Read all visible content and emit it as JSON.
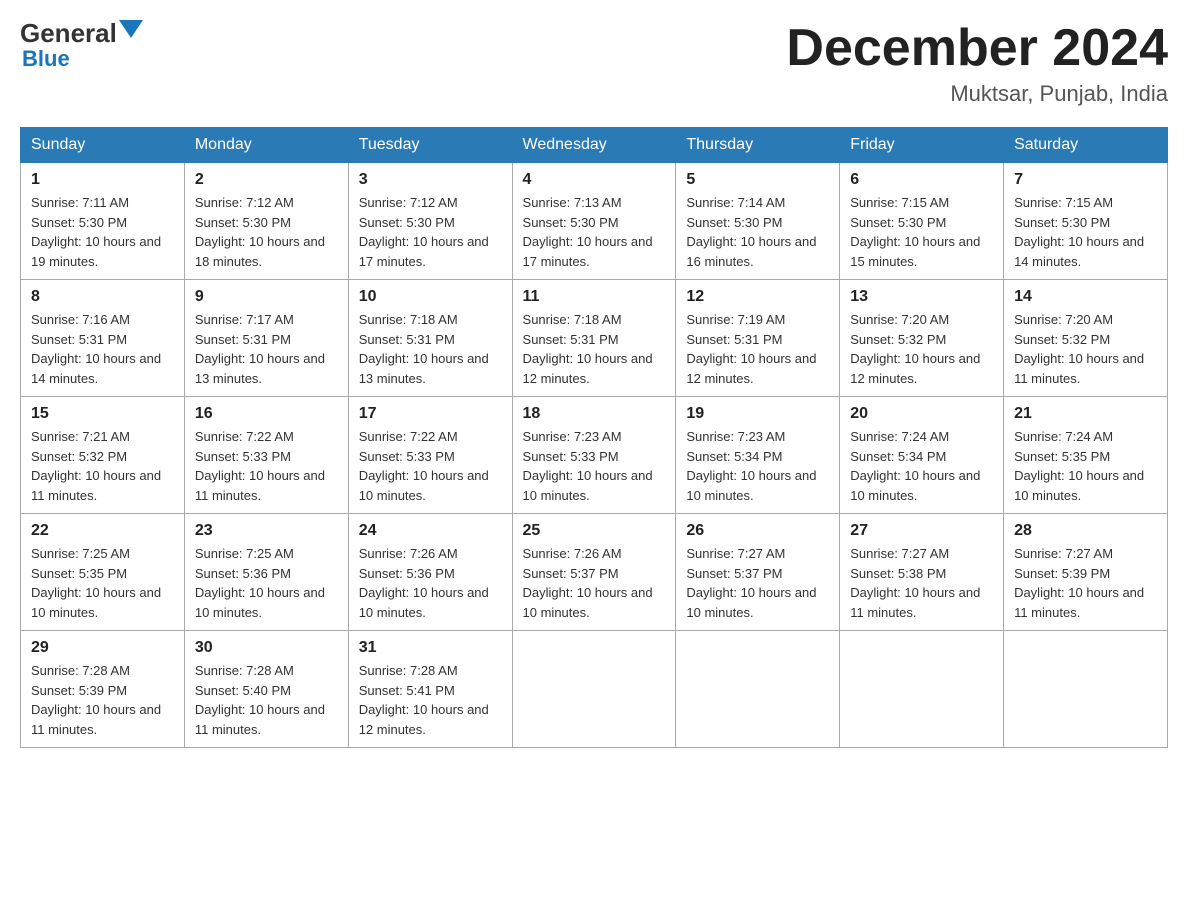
{
  "header": {
    "logo_general": "General",
    "logo_blue": "Blue",
    "month_title": "December 2024",
    "location": "Muktsar, Punjab, India"
  },
  "days_of_week": [
    "Sunday",
    "Monday",
    "Tuesday",
    "Wednesday",
    "Thursday",
    "Friday",
    "Saturday"
  ],
  "weeks": [
    [
      {
        "num": "1",
        "sunrise": "7:11 AM",
        "sunset": "5:30 PM",
        "daylight": "10 hours and 19 minutes."
      },
      {
        "num": "2",
        "sunrise": "7:12 AM",
        "sunset": "5:30 PM",
        "daylight": "10 hours and 18 minutes."
      },
      {
        "num": "3",
        "sunrise": "7:12 AM",
        "sunset": "5:30 PM",
        "daylight": "10 hours and 17 minutes."
      },
      {
        "num": "4",
        "sunrise": "7:13 AM",
        "sunset": "5:30 PM",
        "daylight": "10 hours and 17 minutes."
      },
      {
        "num": "5",
        "sunrise": "7:14 AM",
        "sunset": "5:30 PM",
        "daylight": "10 hours and 16 minutes."
      },
      {
        "num": "6",
        "sunrise": "7:15 AM",
        "sunset": "5:30 PM",
        "daylight": "10 hours and 15 minutes."
      },
      {
        "num": "7",
        "sunrise": "7:15 AM",
        "sunset": "5:30 PM",
        "daylight": "10 hours and 14 minutes."
      }
    ],
    [
      {
        "num": "8",
        "sunrise": "7:16 AM",
        "sunset": "5:31 PM",
        "daylight": "10 hours and 14 minutes."
      },
      {
        "num": "9",
        "sunrise": "7:17 AM",
        "sunset": "5:31 PM",
        "daylight": "10 hours and 13 minutes."
      },
      {
        "num": "10",
        "sunrise": "7:18 AM",
        "sunset": "5:31 PM",
        "daylight": "10 hours and 13 minutes."
      },
      {
        "num": "11",
        "sunrise": "7:18 AM",
        "sunset": "5:31 PM",
        "daylight": "10 hours and 12 minutes."
      },
      {
        "num": "12",
        "sunrise": "7:19 AM",
        "sunset": "5:31 PM",
        "daylight": "10 hours and 12 minutes."
      },
      {
        "num": "13",
        "sunrise": "7:20 AM",
        "sunset": "5:32 PM",
        "daylight": "10 hours and 12 minutes."
      },
      {
        "num": "14",
        "sunrise": "7:20 AM",
        "sunset": "5:32 PM",
        "daylight": "10 hours and 11 minutes."
      }
    ],
    [
      {
        "num": "15",
        "sunrise": "7:21 AM",
        "sunset": "5:32 PM",
        "daylight": "10 hours and 11 minutes."
      },
      {
        "num": "16",
        "sunrise": "7:22 AM",
        "sunset": "5:33 PM",
        "daylight": "10 hours and 11 minutes."
      },
      {
        "num": "17",
        "sunrise": "7:22 AM",
        "sunset": "5:33 PM",
        "daylight": "10 hours and 10 minutes."
      },
      {
        "num": "18",
        "sunrise": "7:23 AM",
        "sunset": "5:33 PM",
        "daylight": "10 hours and 10 minutes."
      },
      {
        "num": "19",
        "sunrise": "7:23 AM",
        "sunset": "5:34 PM",
        "daylight": "10 hours and 10 minutes."
      },
      {
        "num": "20",
        "sunrise": "7:24 AM",
        "sunset": "5:34 PM",
        "daylight": "10 hours and 10 minutes."
      },
      {
        "num": "21",
        "sunrise": "7:24 AM",
        "sunset": "5:35 PM",
        "daylight": "10 hours and 10 minutes."
      }
    ],
    [
      {
        "num": "22",
        "sunrise": "7:25 AM",
        "sunset": "5:35 PM",
        "daylight": "10 hours and 10 minutes."
      },
      {
        "num": "23",
        "sunrise": "7:25 AM",
        "sunset": "5:36 PM",
        "daylight": "10 hours and 10 minutes."
      },
      {
        "num": "24",
        "sunrise": "7:26 AM",
        "sunset": "5:36 PM",
        "daylight": "10 hours and 10 minutes."
      },
      {
        "num": "25",
        "sunrise": "7:26 AM",
        "sunset": "5:37 PM",
        "daylight": "10 hours and 10 minutes."
      },
      {
        "num": "26",
        "sunrise": "7:27 AM",
        "sunset": "5:37 PM",
        "daylight": "10 hours and 10 minutes."
      },
      {
        "num": "27",
        "sunrise": "7:27 AM",
        "sunset": "5:38 PM",
        "daylight": "10 hours and 11 minutes."
      },
      {
        "num": "28",
        "sunrise": "7:27 AM",
        "sunset": "5:39 PM",
        "daylight": "10 hours and 11 minutes."
      }
    ],
    [
      {
        "num": "29",
        "sunrise": "7:28 AM",
        "sunset": "5:39 PM",
        "daylight": "10 hours and 11 minutes."
      },
      {
        "num": "30",
        "sunrise": "7:28 AM",
        "sunset": "5:40 PM",
        "daylight": "10 hours and 11 minutes."
      },
      {
        "num": "31",
        "sunrise": "7:28 AM",
        "sunset": "5:41 PM",
        "daylight": "10 hours and 12 minutes."
      },
      null,
      null,
      null,
      null
    ]
  ]
}
